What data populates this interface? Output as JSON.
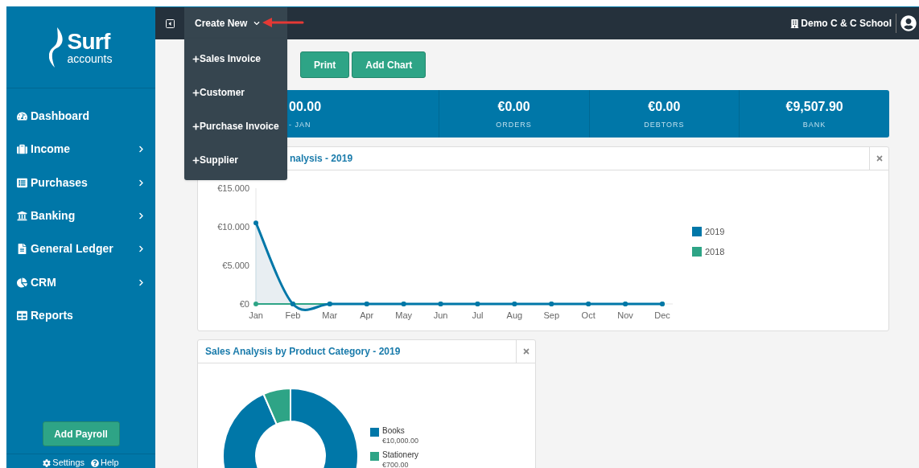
{
  "sidebar": {
    "logo": {
      "name": "Surf",
      "tagline": "accounts"
    },
    "items": [
      {
        "label": "Dashboard",
        "has_submenu": false
      },
      {
        "label": "Income",
        "has_submenu": true
      },
      {
        "label": "Purchases",
        "has_submenu": true
      },
      {
        "label": "Banking",
        "has_submenu": true
      },
      {
        "label": "General Ledger",
        "has_submenu": true
      },
      {
        "label": "CRM",
        "has_submenu": true
      },
      {
        "label": "Reports",
        "has_submenu": false
      }
    ],
    "add_payroll": "Add Payroll",
    "footer": [
      "Settings",
      "Help"
    ]
  },
  "topbar": {
    "create_new": {
      "label": "Create New",
      "expanded": true
    },
    "menu": [
      "Sales Invoice",
      "Customer",
      "Purchase Invoice",
      "Supplier"
    ],
    "company": "Demo C & C School"
  },
  "toolbar": [
    "Print",
    "Add Chart"
  ],
  "stats": [
    {
      "value": "00.00",
      "label": "- JAN"
    },
    {
      "value": "€0.00",
      "label": "ORDERS"
    },
    {
      "value": "€0.00",
      "label": "DEBTORS"
    },
    {
      "value": "€9,507.90",
      "label": "BANK"
    }
  ],
  "charts": [
    {
      "title": "nalysis - 2019",
      "chart_data": {
        "type": "line",
        "categories": [
          "Jan",
          "Feb",
          "Mar",
          "Apr",
          "May",
          "Jun",
          "Jul",
          "Aug",
          "Sep",
          "Oct",
          "Nov",
          "Dec"
        ],
        "series": [
          {
            "name": "2019",
            "color": "#0077a8",
            "values": [
              10.5,
              0,
              0,
              0,
              0,
              0,
              0,
              0,
              0,
              0,
              0,
              0
            ],
            "marker": "circle"
          },
          {
            "name": "2018",
            "color": "#2ea486",
            "values": [
              0,
              0,
              0,
              0,
              0,
              0,
              0,
              0,
              0,
              0,
              0,
              0
            ],
            "marker": "circle"
          }
        ],
        "ylim": [
          0,
          15
        ],
        "yticks": [
          {
            "value": 0,
            "label": "€0"
          },
          {
            "value": 5,
            "label": "€5.000"
          },
          {
            "value": 10,
            "label": "€10.000"
          },
          {
            "value": 15,
            "label": "€15.000"
          }
        ],
        "legend": "right"
      }
    },
    {
      "title": "Sales Analysis by Product Category - 2019",
      "chart_data": {
        "type": "donut",
        "categories": [
          "Books",
          "Stationery"
        ],
        "values": [
          10000,
          700
        ],
        "value_labels": [
          "€10,000.00",
          "€700.00"
        ],
        "legend": "right"
      }
    }
  ]
}
